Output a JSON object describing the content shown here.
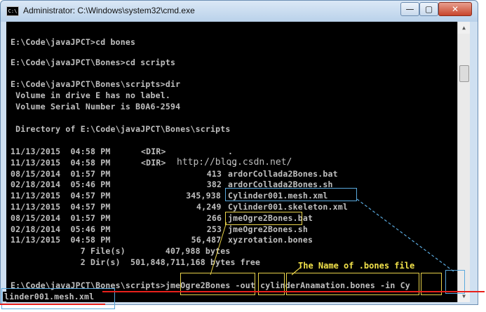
{
  "window": {
    "title": "Administrator: C:\\Windows\\system32\\cmd.exe",
    "icon_label": "C:\\",
    "controls": {
      "minimize": "—",
      "maximize": "▢",
      "close": "✕"
    }
  },
  "console": {
    "lines": [
      "E:\\Code\\javaJPCT>cd bones",
      "E:\\Code\\javaJPCT\\Bones>cd scripts",
      "E:\\Code\\javaJPCT\\Bones\\scripts>dir",
      " Volume in drive E has no label.",
      " Volume Serial Number is B0A6-2594",
      " Directory of E:\\Code\\javaJPCT\\Bones\\scripts"
    ],
    "dir_rows": [
      {
        "date": "11/13/2015",
        "time": "04:58 PM",
        "size": "<DIR>",
        "name": "."
      },
      {
        "date": "11/13/2015",
        "time": "04:58 PM",
        "size": "<DIR>",
        "name": ".."
      },
      {
        "date": "08/15/2014",
        "time": "01:57 PM",
        "size": "413",
        "name": "ardorCollada2Bones.bat"
      },
      {
        "date": "02/18/2014",
        "time": "05:46 PM",
        "size": "382",
        "name": "ardorCollada2Bones.sh"
      },
      {
        "date": "11/13/2015",
        "time": "04:57 PM",
        "size": "345,938",
        "name": "Cylinder001.mesh.xml"
      },
      {
        "date": "11/13/2015",
        "time": "04:57 PM",
        "size": "4,249",
        "name": "Cylinder001.skeleton.xml"
      },
      {
        "date": "08/15/2014",
        "time": "01:57 PM",
        "size": "266",
        "name": "jmeOgre2Bones.bat"
      },
      {
        "date": "02/18/2014",
        "time": "05:46 PM",
        "size": "253",
        "name": "jmeOgre2Bones.sh"
      },
      {
        "date": "11/13/2015",
        "time": "04:58 PM",
        "size": "56,487",
        "name": "xyzrotation.bones"
      }
    ],
    "summary": [
      "              7 File(s)        407,988 bytes",
      "              2 Dir(s)  501,848,711,168 bytes free"
    ],
    "command": "E:\\Code\\javaJPCT\\Bones\\scripts>jmeOgre2Bones -out cylinderAnamation.bones -in Cy",
    "command_wrap": "linder001.mesh.xml"
  },
  "annotations": {
    "watermark": "http://blog.csdn.net/",
    "note": "The Name of .bones file"
  },
  "colors": {
    "console_bg": "#000000",
    "console_text": "#c0c0c0",
    "highlight_blue": "#5aa9dd",
    "highlight_yellow": "#e8d24a",
    "underline_red": "#e8201b"
  }
}
